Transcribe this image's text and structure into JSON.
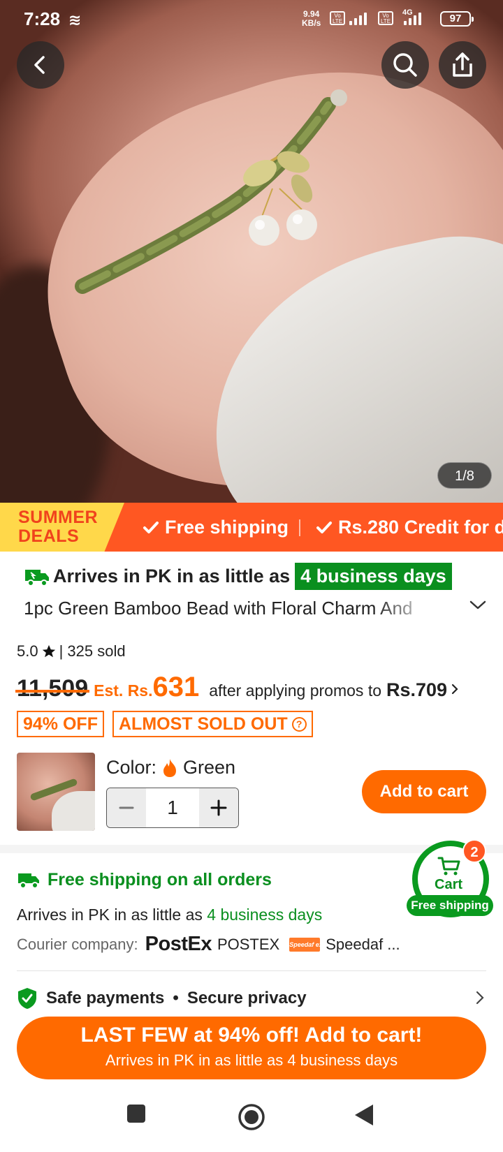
{
  "status_bar": {
    "time": "7:28",
    "net_speed_value": "9.94",
    "net_speed_unit": "KB/s",
    "lte1": "Vo LTE",
    "lte2": "Vo LTE",
    "network_type": "4G",
    "battery": "97"
  },
  "gallery": {
    "counter": "1/8"
  },
  "promo_banner": {
    "badge_line1": "SUMMER",
    "badge_line2": "DEALS",
    "item1": "Free shipping",
    "item2": "Rs.280 Credit for d"
  },
  "product": {
    "arrival_prefix": "Arrives in PK in as little as",
    "arrival_days": "4 business days",
    "title": "1pc Green Bamboo Bead with Floral Charm And",
    "rating": "5.0",
    "sold": "| 325 sold",
    "original_price": "11,509",
    "est_label": "Est. Rs.",
    "est_price": "631",
    "after_promo_text": "after applying promos to",
    "promo_price": "Rs.709",
    "tag_off": "94% OFF",
    "tag_sold_out": "ALMOST SOLD OUT",
    "color_label": "Color:",
    "color_value": "Green",
    "quantity": "1",
    "add_to_cart": "Add to cart"
  },
  "shipping": {
    "heading": "Free shipping on all orders",
    "arrives_prefix": "Arrives in PK in as little as",
    "arrives_days": "4 business days",
    "courier_label": "Courier company:",
    "courier1_logo": "PostEx",
    "courier1_name": "POSTEX",
    "courier2_logo": "Speedaf express",
    "courier2_name": "Speedaf ..."
  },
  "cart_float": {
    "label": "Cart",
    "count": "2",
    "free_shipping": "Free shipping"
  },
  "safety": {
    "text1": "Safe payments",
    "bullet": "•",
    "text2": "Secure privacy"
  },
  "cta": {
    "main": "LAST FEW at 94% off! Add to cart!",
    "sub": "Arrives in PK in as little as 4 business days"
  },
  "colors": {
    "accent_orange": "#ff6a00",
    "banner_red": "#ff5722",
    "badge_yellow": "#ffd84a",
    "green": "#0a8f1f"
  },
  "icons": [
    "back-icon",
    "search-icon",
    "share-icon",
    "truck-icon",
    "star-icon",
    "flame-icon",
    "minus-icon",
    "plus-icon",
    "cart-icon",
    "shield-check-icon",
    "chevron-right-icon",
    "chevron-down-icon",
    "help-icon"
  ]
}
